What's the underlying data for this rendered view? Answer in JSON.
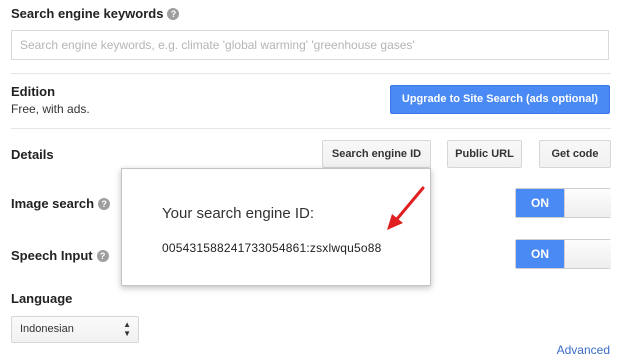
{
  "keywords": {
    "label": "Search engine keywords",
    "help_icon": "?",
    "placeholder": "Search engine keywords, e.g. climate 'global warming' 'greenhouse gases'",
    "value": ""
  },
  "edition": {
    "label": "Edition",
    "value": "Free, with ads.",
    "upgrade_button": "Upgrade to Site Search (ads optional)"
  },
  "details": {
    "label": "Details",
    "buttons": [
      "Search engine ID",
      "Public URL",
      "Get code"
    ]
  },
  "image_search": {
    "label": "Image search",
    "help_icon": "?",
    "toggle": "ON"
  },
  "speech_input": {
    "label": "Speech Input",
    "help_icon": "?",
    "toggle": "ON"
  },
  "language": {
    "label": "Language",
    "selected": "Indonesian"
  },
  "advanced_link": "Advanced",
  "popup": {
    "title": "Your search engine ID:",
    "engine_id": "005431588241733054861:zsxlwqu5o88"
  },
  "colors": {
    "accent": "#4a8af4",
    "annotation_arrow": "#e02020",
    "link": "#3b6cc7"
  },
  "icons": [
    "help-icon",
    "annotation-arrow-icon",
    "select-arrows-icon"
  ]
}
